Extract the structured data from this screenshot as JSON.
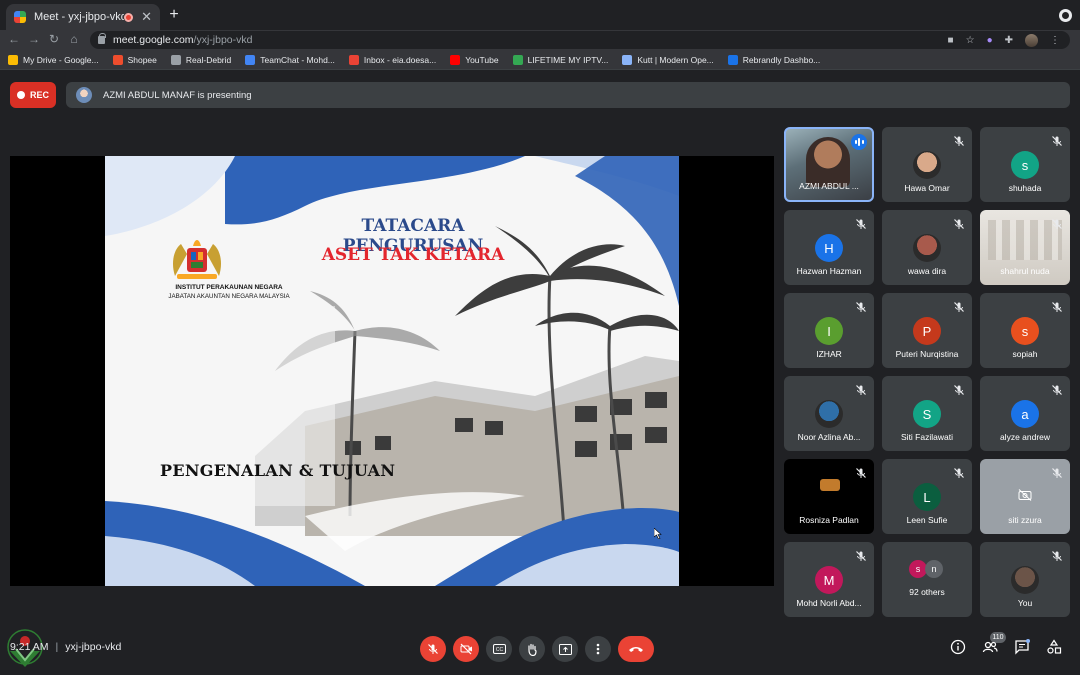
{
  "browser": {
    "tab_title": "Meet - yxj-jbpo-vkd",
    "url_host": "meet.google.com",
    "url_path": "/yxj-jbpo-vkd",
    "bookmarks": [
      {
        "label": "My Drive - Google...",
        "color": "#fbbc04"
      },
      {
        "label": "Shopee",
        "color": "#ee4d2d"
      },
      {
        "label": "Real-Debrid",
        "color": "#9aa0a6"
      },
      {
        "label": "TeamChat - Mohd...",
        "color": "#4285f4"
      },
      {
        "label": "Inbox - eia.doesa...",
        "color": "#ea4335"
      },
      {
        "label": "YouTube",
        "color": "#ff0000"
      },
      {
        "label": "LIFETIME MY IPTV...",
        "color": "#34a853"
      },
      {
        "label": "Kutt | Modern Ope...",
        "color": "#8ab4f8"
      },
      {
        "label": "Rebrandly Dashbo...",
        "color": "#1a73e8"
      }
    ]
  },
  "meet": {
    "rec_label": "REC",
    "presenting_text": "AZMI ABDUL MANAF is presenting",
    "meeting_code": "yxj-jbpo-vkd",
    "time": "9:21 AM",
    "participant_count": "110",
    "tiles": [
      {
        "name": "AZMI ABDUL ...",
        "type": "video",
        "speaking": true
      },
      {
        "name": "Hawa Omar",
        "type": "photo",
        "color": "#d9a98a"
      },
      {
        "name": "shuhada",
        "type": "letter",
        "letter": "s",
        "color": "#12a486"
      },
      {
        "name": "Hazwan Hazman",
        "type": "letter",
        "letter": "H",
        "color": "#1a73e8"
      },
      {
        "name": "wawa dira",
        "type": "photo",
        "color": "#a85a4c"
      },
      {
        "name": "shahrul nuda",
        "type": "video-light"
      },
      {
        "name": "IZHAR",
        "type": "letter",
        "letter": "I",
        "color": "#5a9e2f"
      },
      {
        "name": "Puteri Nurqistina",
        "type": "letter",
        "letter": "P",
        "color": "#c5391c"
      },
      {
        "name": "sopiah",
        "type": "letter",
        "letter": "s",
        "color": "#e8501e"
      },
      {
        "name": "Noor Azlina Ab...",
        "type": "photo",
        "color": "#2f6fa8"
      },
      {
        "name": "Siti Fazilawati",
        "type": "letter",
        "letter": "S",
        "color": "#12a486"
      },
      {
        "name": "alyze andrew",
        "type": "letter",
        "letter": "a",
        "color": "#1a73e8"
      },
      {
        "name": "Rosniza Padlan",
        "type": "video-dark"
      },
      {
        "name": "Leen Sufie",
        "type": "letter",
        "letter": "L",
        "color": "#0b5e3f"
      },
      {
        "name": "siti zzura",
        "type": "camera-off"
      },
      {
        "name": "Mohd Norli Abd...",
        "type": "letter",
        "letter": "M",
        "color": "#c2185b"
      },
      {
        "name": "92 others",
        "type": "others"
      },
      {
        "name": "You",
        "type": "photo",
        "color": "#6b5448"
      }
    ]
  },
  "slide": {
    "title_line1": "TATACARA PENGURUSAN",
    "title_line2": "ASET TAK KETARA",
    "institute_line1": "INSTITUT PERAKAUNAN NEGARA",
    "institute_line2": "JABATAN AKAUNTAN NEGARA MALAYSIA",
    "heading": "PENGENALAN & TUJUAN"
  },
  "colors": {
    "rec": "#d93025",
    "end_call": "#ea4335",
    "slide_blue": "#2f63b8",
    "slide_red": "#e3262e"
  }
}
